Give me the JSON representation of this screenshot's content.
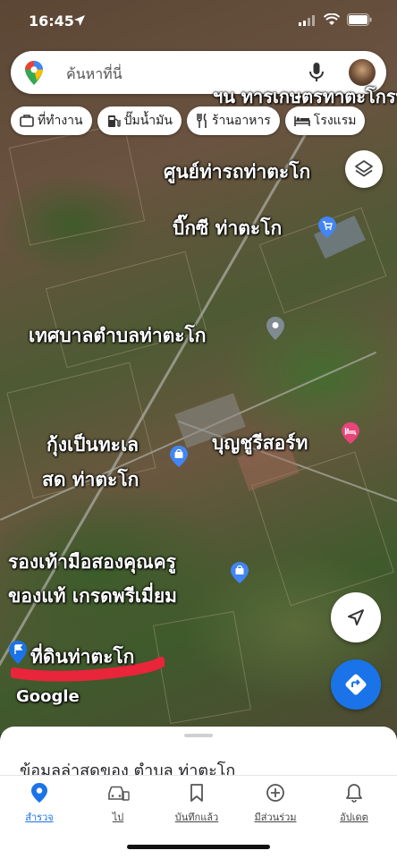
{
  "status_bar": {
    "time": "16:45"
  },
  "search": {
    "placeholder": "ค้นหาที่นี่"
  },
  "chips": [
    {
      "label": "ที่ทำงาน",
      "icon": "briefcase-icon"
    },
    {
      "label": "ปั๊มน้ำมัน",
      "icon": "gas-station-icon"
    },
    {
      "label": "ร้านอาหาร",
      "icon": "restaurant-icon"
    },
    {
      "label": "โรงแรม",
      "icon": "hotel-icon"
    }
  ],
  "map_labels": {
    "top_cut": "ฯน ทารเกษตรทาตะโกรท",
    "bus_terminal": "ศูนย์ท่ารถท่าตะโก",
    "bigc": "บิ๊กซี ท่าตะโก",
    "municipality": "เทศบาลตำบลท่าตะโก",
    "shrimp_line1": "กุ้งเป็นทะเล",
    "shrimp_line2": "สด ท่าตะโก",
    "resort": "บุญชูรีสอร์ท",
    "shoes_line1": "รองเท้ามือสองคุณครู",
    "shoes_line2": "ของแท้ เกรดพรีเมี่ยม",
    "saved_place": "ที่ดินท่าตะโก"
  },
  "map_brand": "Google",
  "sheet": {
    "title": "ข้อมูลล่าสุดของ ตำบล ท่าตะโก"
  },
  "nav": [
    {
      "label": "สำรวจ",
      "icon": "explore-pin-icon",
      "active": true
    },
    {
      "label": "ไป",
      "icon": "car-icon",
      "active": false
    },
    {
      "label": "บันทึกแล้ว",
      "icon": "bookmark-icon",
      "active": false
    },
    {
      "label": "มีส่วนร่วม",
      "icon": "add-circle-icon",
      "active": false
    },
    {
      "label": "อัปเดต",
      "icon": "bell-icon",
      "active": false
    }
  ],
  "colors": {
    "accent_blue": "#1a73e8",
    "bigc_pin": "#4285f4",
    "resort_pin": "#e8457a",
    "gov_pin": "#7f8a93",
    "underline_red": "#e8253a"
  }
}
